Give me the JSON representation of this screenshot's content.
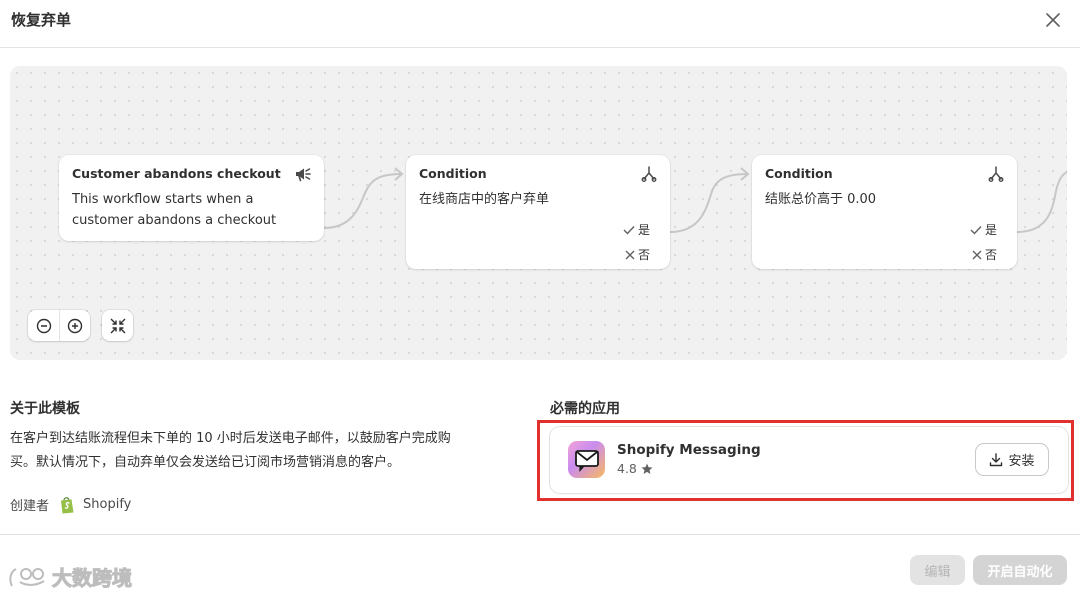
{
  "modal": {
    "title": "恢复弃单"
  },
  "icons": {
    "close": "close-icon",
    "trigger": "megaphone-icon",
    "condition": "branch-icon",
    "zoom_out": "zoom-out-icon",
    "zoom_in": "zoom-in-icon",
    "fit": "collapse-icon",
    "install": "download-icon",
    "rating_star": "star-icon"
  },
  "workflow": {
    "trigger": {
      "title": "Customer abandons checkout",
      "description_line1": "This workflow starts when a",
      "description_line2": "customer abandons a checkout"
    },
    "conditions": [
      {
        "title": "Condition",
        "description": "在线商店中的客户弃单",
        "yes_label": "是",
        "no_label": "否"
      },
      {
        "title": "Condition",
        "description": "结账总价高于 0.00",
        "yes_label": "是",
        "no_label": "否"
      }
    ]
  },
  "about": {
    "heading": "关于此模板",
    "line1": "在客户到达结账流程但未下单的 10 小时后发送电子邮件，以鼓励客户完成购",
    "line2": "买。默认情况下，自动弃单仅会发送给已订阅市场营销消息的客户。",
    "creator_label": "创建者",
    "creator_name": "Shopify"
  },
  "required_apps": {
    "heading": "必需的应用",
    "apps": [
      {
        "name": "Shopify Messaging",
        "rating": "4.8",
        "install_label": "安装"
      }
    ]
  },
  "footer": {
    "edit_label": "编辑",
    "automate_label": "开启自动化"
  },
  "watermark": {
    "text": "大数跨境"
  },
  "colors": {
    "highlight": "#e1312e",
    "canvas_bg": "#f1f1f1",
    "disabled_button": "#d4d4d4"
  }
}
